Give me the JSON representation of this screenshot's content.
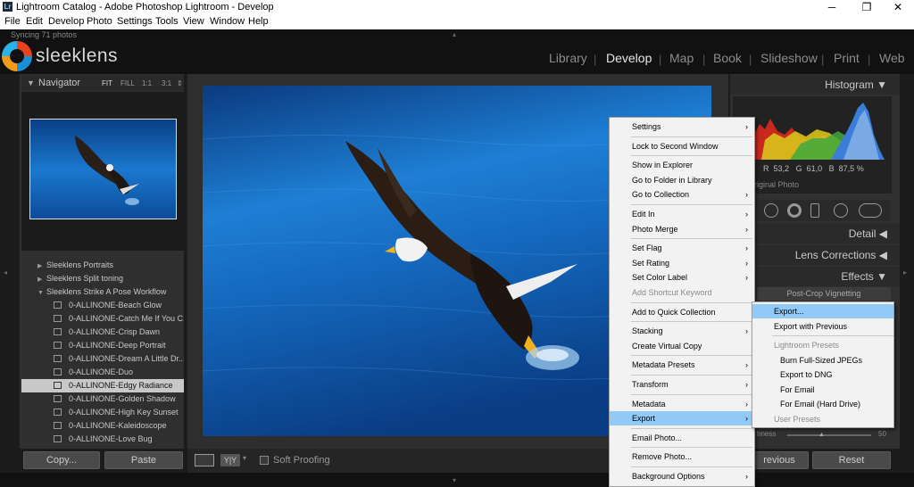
{
  "window": {
    "title": "Lightroom Catalog - Adobe Photoshop Lightroom - Develop",
    "app_icon": "Lr",
    "controls": [
      "─",
      "❐",
      "✕"
    ]
  },
  "menubar": [
    "File",
    "Edit",
    "Develop",
    "Photo",
    "Settings",
    "Tools",
    "View",
    "Window",
    "Help"
  ],
  "top": {
    "sync_status": "Syncing 71 photos",
    "brand": "sleeklens",
    "modules": [
      "Library",
      "Develop",
      "Map",
      "Book",
      "Slideshow",
      "Print",
      "Web"
    ],
    "active_module": "Develop"
  },
  "navigator": {
    "title": "Navigator",
    "zoom_options": [
      "FIT",
      "FILL",
      "1:1",
      "3:1"
    ]
  },
  "presets": {
    "folders": [
      "Sleeklens Portraits",
      "Sleeklens Split toning",
      "Sleeklens Strike A Pose Workflow"
    ],
    "items": [
      "0-ALLINONE-Beach Glow",
      "0-ALLINONE-Catch Me If You C...",
      "0-ALLINONE-Crisp Dawn",
      "0-ALLINONE-Deep Portrait",
      "0-ALLINONE-Dream A Little Dr...",
      "0-ALLINONE-Duo",
      "0-ALLINONE-Edgy Radiance",
      "0-ALLINONE-Golden Shadow",
      "0-ALLINONE-High Key Sunset",
      "0-ALLINONE-Kaleidoscope",
      "0-ALLINONE-Love Bug"
    ],
    "selected_index": 6
  },
  "left_buttons": {
    "copy": "Copy...",
    "paste": "Paste"
  },
  "toolbar": {
    "soft_proofing": "Soft Proofing",
    "yy": "Y|Y"
  },
  "right_panel": {
    "histogram_title": "Histogram",
    "rgb": {
      "r_label": "R",
      "r": "53,2",
      "g_label": "G",
      "g": "61,0",
      "b_label": "B",
      "b": "87,5",
      "unit": "%"
    },
    "original_photo": "riginal Photo",
    "detail": "Detail",
    "lens_corrections": "Lens Corrections",
    "effects": "Effects",
    "post_crop": "Post-Crop Vignetting",
    "slider_label": "hness",
    "slider_value": "50",
    "previous": "revious",
    "reset": "Reset"
  },
  "context_menu": {
    "items": [
      {
        "label": "Settings",
        "submenu": true
      },
      {
        "sep": true
      },
      {
        "label": "Lock to Second Window"
      },
      {
        "sep": true
      },
      {
        "label": "Show in Explorer"
      },
      {
        "label": "Go to Folder in Library"
      },
      {
        "label": "Go to Collection",
        "submenu": true
      },
      {
        "sep": true
      },
      {
        "label": "Edit In",
        "submenu": true
      },
      {
        "label": "Photo Merge",
        "submenu": true
      },
      {
        "sep": true
      },
      {
        "label": "Set Flag",
        "submenu": true
      },
      {
        "label": "Set Rating",
        "submenu": true
      },
      {
        "label": "Set Color Label",
        "submenu": true
      },
      {
        "label": "Add Shortcut Keyword",
        "disabled": true
      },
      {
        "sep": true
      },
      {
        "label": "Add to Quick Collection"
      },
      {
        "sep": true
      },
      {
        "label": "Stacking",
        "submenu": true
      },
      {
        "label": "Create Virtual Copy"
      },
      {
        "sep": true
      },
      {
        "label": "Metadata Presets",
        "submenu": true
      },
      {
        "sep": true
      },
      {
        "label": "Transform",
        "submenu": true
      },
      {
        "sep": true
      },
      {
        "label": "Metadata",
        "submenu": true
      },
      {
        "label": "Export",
        "submenu": true,
        "highlighted": true
      },
      {
        "sep": true
      },
      {
        "label": "Email Photo..."
      },
      {
        "sep": true
      },
      {
        "label": "Remove Photo..."
      },
      {
        "sep": true
      },
      {
        "label": "Background Options",
        "submenu": true
      }
    ]
  },
  "export_submenu": {
    "items": [
      {
        "label": "Export...",
        "highlighted": true
      },
      {
        "label": "Export with Previous"
      },
      {
        "sep": true
      },
      {
        "label": "Lightroom Presets",
        "disabled": true
      },
      {
        "label": "Burn Full-Sized JPEGs",
        "indent": true
      },
      {
        "label": "Export to DNG",
        "indent": true
      },
      {
        "label": "For Email",
        "indent": true
      },
      {
        "label": "For Email (Hard Drive)",
        "indent": true
      },
      {
        "label": "User Presets",
        "disabled": true
      }
    ]
  },
  "colors": {
    "menu_highlight": "#91c9f7",
    "photo_blue": "#0c56a7"
  }
}
